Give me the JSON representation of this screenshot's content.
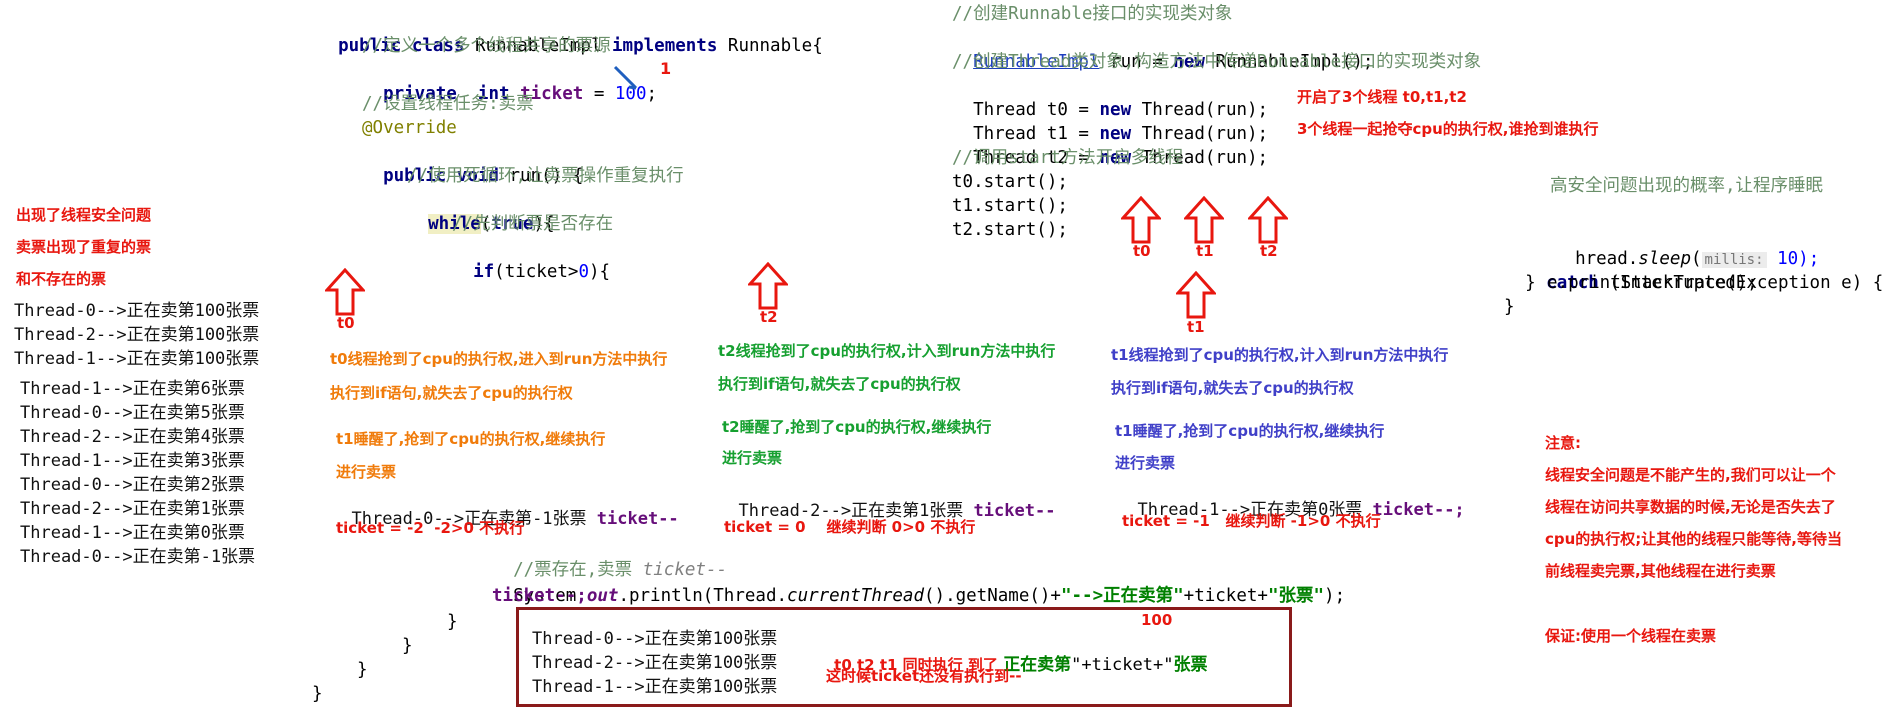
{
  "code_left": {
    "l1_a": "public class ",
    "l1_b": "RunnableImpl ",
    "l1_c": "implements",
    "l1_d": " Runnable{",
    "l2": "//定义一个多个线程共享的票源",
    "l3_a": "private",
    "l3_b": "  int ",
    "l3_c": "ticket",
    "l3_d": " = ",
    "l3_e": "100",
    "l3_f": ";",
    "l4": "//设置线程任务:卖票",
    "l5": "@Override",
    "l6_a": "public void",
    "l6_b": " run() {",
    "l7": "//使用死循环,让卖票操作重复执行",
    "l8_a": "while",
    "l8_b": "(",
    "l8_c": "true",
    "l8_d": "){",
    "l9": "//先判断票是否存在",
    "l10_a": "if",
    "l10_b": "(ticket>",
    "l10_c": "0",
    "l10_d": "){",
    "l11_a": "//票存在,卖票 ",
    "l11_b": "ticket--",
    "l12_a": "System.",
    "l12_b": "out",
    "l12_c": ".println(Thread.",
    "l12_d": "currentThread",
    "l12_e": "().getName()+",
    "l12_f": "\"-->正在卖第\"",
    "l12_g": "+ticket+",
    "l12_h": "\"张票\"",
    "l12_i": ");",
    "l13": "ticket--;",
    "l14": "}",
    "l15": "}",
    "l16": "}",
    "l17": "}",
    "marker_one": "1"
  },
  "code_right": {
    "r1": "//创建Runnable接口的实现类对象",
    "r2_a": "RunnableImpl",
    "r2_b": " run = ",
    "r2_c": "new",
    "r2_d": " RunnableImpl();",
    "r3": "//创建Thread类对象,构造方法中传递Runnable接口的实现类对象",
    "r4_a": "Thread t0 = ",
    "r4_b": "new",
    "r4_c": " Thread(run);",
    "r5_a": "Thread t1 = ",
    "r5_b": "new",
    "r5_c": " Thread(run);",
    "r6_a": "Thread t2 = ",
    "r6_b": "new",
    "r6_c": " Thread(run);",
    "r7": "//调用start方法开启多线程",
    "r8": "t0.start();",
    "r9": "t1.start();",
    "r10": "t2.start();",
    "note1": "开启了3个线程 t0,t1,t2",
    "note2": "3个线程一起抢夺cpu的执行权,谁抢到谁执行"
  },
  "code_far_right": {
    "f1": "高安全问题出现的概率,让程序睡眠",
    "f2_a": "hread.",
    "f2_b": "sleep",
    "f2_c": "(",
    "f2_hint": "millis:",
    "f2_d": " 10);",
    "f3_a": "} ",
    "f3_b": "catch",
    "f3_c": " (InterruptedException e) {",
    "f4": "e.printStackTrace();",
    "f5": "}"
  },
  "left_notes": {
    "n1": "出现了线程安全问题",
    "n2": "卖票出现了重复的票",
    "n3": "和不存在的票"
  },
  "left_output": [
    "Thread-0-->正在卖第100张票",
    "Thread-2-->正在卖第100张票",
    "Thread-1-->正在卖第100张票",
    "Thread-1-->正在卖第6张票",
    "Thread-0-->正在卖第5张票",
    "Thread-2-->正在卖第4张票",
    "Thread-1-->正在卖第3张票",
    "Thread-0-->正在卖第2张票",
    "Thread-2-->正在卖第1张票",
    "Thread-1-->正在卖第0张票",
    "Thread-0-->正在卖第-1张票"
  ],
  "arrows": {
    "t0a": "t0",
    "t2a": "t2",
    "t1a": "t1",
    "s_t0": "t0",
    "s_t1": "t1",
    "s_t2": "t2"
  },
  "col_t0": {
    "a": "t0线程抢到了cpu的执行权,进入到run方法中执行",
    "b": "执行到if语句,就失去了cpu的执行权",
    "c": "t1睡醒了,抢到了cpu的执行权,继续执行",
    "d": "进行卖票",
    "out_a": "Thread-0-->正在卖第-1张票 ",
    "out_b": "ticket--",
    "e": "ticket = -2  -2>0 不执行"
  },
  "col_t2": {
    "a": "t2线程抢到了cpu的执行权,计入到run方法中执行",
    "b": "执行到if语句,就失去了cpu的执行权",
    "c": "t2睡醒了,抢到了cpu的执行权,继续执行",
    "d": "进行卖票",
    "out_a": "Thread-2-->正在卖第1张票 ",
    "out_b": "ticket--",
    "e": "ticket = 0    继续判断 0>0 不执行"
  },
  "col_t1": {
    "a": "t1线程抢到了cpu的执行权,计入到run方法中执行",
    "b": "执行到if语句,就失去了cpu的执行权",
    "c": "t1睡醒了,抢到了cpu的执行权,继续执行",
    "d": "进行卖票",
    "out_a": "Thread-1-->正在卖第0张票 ",
    "out_b": "ticket--;",
    "e": "ticket = -1   继续判断 -1>0 不执行"
  },
  "box": {
    "l1": "Thread-0-->正在卖第100张票",
    "l2": "Thread-2-->正在卖第100张票",
    "l3": "Thread-1-->正在卖第100张票",
    "num": "100",
    "desc_a": "t0 t2 t1 同时执行 到了 ",
    "desc_b": "正在卖第",
    "desc_c": "\"+ticket+\"",
    "desc_d": "张票",
    "desc2": "这时候ticket还没有执行到--"
  },
  "right_notes": {
    "title": "注意:",
    "p1": "线程安全问题是不能产生的,我们可以让一个",
    "p2": "线程在访问共享数据的时候,无论是否失去了",
    "p3": "cpu的执行权;让其他的线程只能等待,等待当",
    "p4": "前线程卖完票,其他线程在进行卖票",
    "p5": "保证:使用一个线程在卖票"
  },
  "colors": {
    "red": "#e8170f",
    "orange": "#f07b0a",
    "green": "#16a030",
    "blue": "#4040c8",
    "box_border": "#8a1a1a"
  }
}
